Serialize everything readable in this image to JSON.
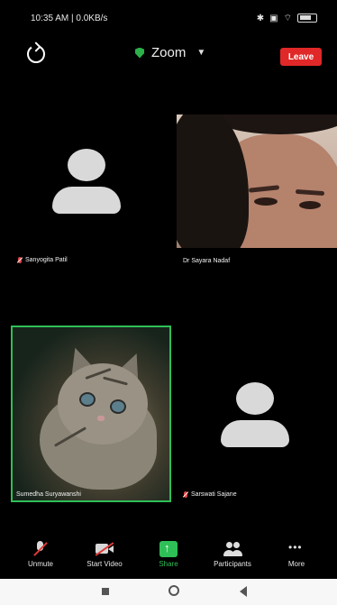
{
  "status_bar": {
    "time_info": "10:35 AM | 0.0KB/s",
    "battery": "100"
  },
  "meeting": {
    "title": "Zoom",
    "leave_label": "Leave",
    "accent_green": "#2fbf57",
    "leave_red": "#e02828"
  },
  "participants": [
    {
      "name": "Sanyogita Patil",
      "video": false,
      "muted": true
    },
    {
      "name": "Dr Sayara Nadaf",
      "video": true,
      "muted": false
    },
    {
      "name": "Sumedha Suryawanshi",
      "video": true,
      "muted": false,
      "active_speaker": true
    },
    {
      "name": "Sarswati Sajane",
      "video": false,
      "muted": true
    }
  ],
  "toolbar": {
    "unmute": "Unmute",
    "start_video": "Start Video",
    "share": "Share",
    "participants": "Participants",
    "more": "More"
  }
}
